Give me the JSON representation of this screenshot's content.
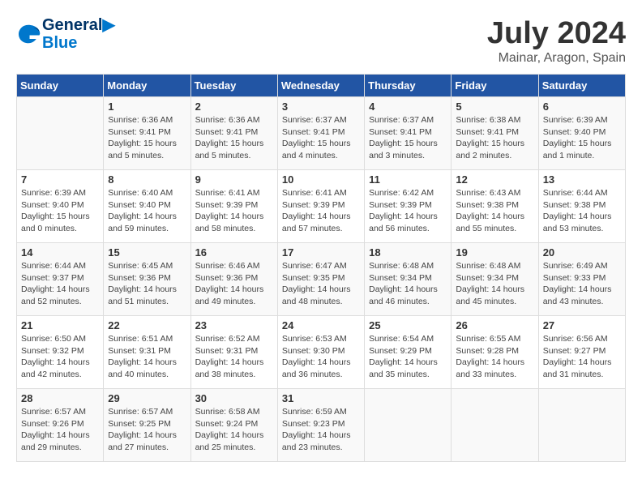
{
  "header": {
    "logo_line1": "General",
    "logo_line2": "Blue",
    "month": "July 2024",
    "location": "Mainar, Aragon, Spain"
  },
  "columns": [
    "Sunday",
    "Monday",
    "Tuesday",
    "Wednesday",
    "Thursday",
    "Friday",
    "Saturday"
  ],
  "weeks": [
    [
      {
        "date": "",
        "info": ""
      },
      {
        "date": "1",
        "info": "Sunrise: 6:36 AM\nSunset: 9:41 PM\nDaylight: 15 hours\nand 5 minutes."
      },
      {
        "date": "2",
        "info": "Sunrise: 6:36 AM\nSunset: 9:41 PM\nDaylight: 15 hours\nand 5 minutes."
      },
      {
        "date": "3",
        "info": "Sunrise: 6:37 AM\nSunset: 9:41 PM\nDaylight: 15 hours\nand 4 minutes."
      },
      {
        "date": "4",
        "info": "Sunrise: 6:37 AM\nSunset: 9:41 PM\nDaylight: 15 hours\nand 3 minutes."
      },
      {
        "date": "5",
        "info": "Sunrise: 6:38 AM\nSunset: 9:41 PM\nDaylight: 15 hours\nand 2 minutes."
      },
      {
        "date": "6",
        "info": "Sunrise: 6:39 AM\nSunset: 9:40 PM\nDaylight: 15 hours\nand 1 minute."
      }
    ],
    [
      {
        "date": "7",
        "info": "Sunrise: 6:39 AM\nSunset: 9:40 PM\nDaylight: 15 hours\nand 0 minutes."
      },
      {
        "date": "8",
        "info": "Sunrise: 6:40 AM\nSunset: 9:40 PM\nDaylight: 14 hours\nand 59 minutes."
      },
      {
        "date": "9",
        "info": "Sunrise: 6:41 AM\nSunset: 9:39 PM\nDaylight: 14 hours\nand 58 minutes."
      },
      {
        "date": "10",
        "info": "Sunrise: 6:41 AM\nSunset: 9:39 PM\nDaylight: 14 hours\nand 57 minutes."
      },
      {
        "date": "11",
        "info": "Sunrise: 6:42 AM\nSunset: 9:39 PM\nDaylight: 14 hours\nand 56 minutes."
      },
      {
        "date": "12",
        "info": "Sunrise: 6:43 AM\nSunset: 9:38 PM\nDaylight: 14 hours\nand 55 minutes."
      },
      {
        "date": "13",
        "info": "Sunrise: 6:44 AM\nSunset: 9:38 PM\nDaylight: 14 hours\nand 53 minutes."
      }
    ],
    [
      {
        "date": "14",
        "info": "Sunrise: 6:44 AM\nSunset: 9:37 PM\nDaylight: 14 hours\nand 52 minutes."
      },
      {
        "date": "15",
        "info": "Sunrise: 6:45 AM\nSunset: 9:36 PM\nDaylight: 14 hours\nand 51 minutes."
      },
      {
        "date": "16",
        "info": "Sunrise: 6:46 AM\nSunset: 9:36 PM\nDaylight: 14 hours\nand 49 minutes."
      },
      {
        "date": "17",
        "info": "Sunrise: 6:47 AM\nSunset: 9:35 PM\nDaylight: 14 hours\nand 48 minutes."
      },
      {
        "date": "18",
        "info": "Sunrise: 6:48 AM\nSunset: 9:34 PM\nDaylight: 14 hours\nand 46 minutes."
      },
      {
        "date": "19",
        "info": "Sunrise: 6:48 AM\nSunset: 9:34 PM\nDaylight: 14 hours\nand 45 minutes."
      },
      {
        "date": "20",
        "info": "Sunrise: 6:49 AM\nSunset: 9:33 PM\nDaylight: 14 hours\nand 43 minutes."
      }
    ],
    [
      {
        "date": "21",
        "info": "Sunrise: 6:50 AM\nSunset: 9:32 PM\nDaylight: 14 hours\nand 42 minutes."
      },
      {
        "date": "22",
        "info": "Sunrise: 6:51 AM\nSunset: 9:31 PM\nDaylight: 14 hours\nand 40 minutes."
      },
      {
        "date": "23",
        "info": "Sunrise: 6:52 AM\nSunset: 9:31 PM\nDaylight: 14 hours\nand 38 minutes."
      },
      {
        "date": "24",
        "info": "Sunrise: 6:53 AM\nSunset: 9:30 PM\nDaylight: 14 hours\nand 36 minutes."
      },
      {
        "date": "25",
        "info": "Sunrise: 6:54 AM\nSunset: 9:29 PM\nDaylight: 14 hours\nand 35 minutes."
      },
      {
        "date": "26",
        "info": "Sunrise: 6:55 AM\nSunset: 9:28 PM\nDaylight: 14 hours\nand 33 minutes."
      },
      {
        "date": "27",
        "info": "Sunrise: 6:56 AM\nSunset: 9:27 PM\nDaylight: 14 hours\nand 31 minutes."
      }
    ],
    [
      {
        "date": "28",
        "info": "Sunrise: 6:57 AM\nSunset: 9:26 PM\nDaylight: 14 hours\nand 29 minutes."
      },
      {
        "date": "29",
        "info": "Sunrise: 6:57 AM\nSunset: 9:25 PM\nDaylight: 14 hours\nand 27 minutes."
      },
      {
        "date": "30",
        "info": "Sunrise: 6:58 AM\nSunset: 9:24 PM\nDaylight: 14 hours\nand 25 minutes."
      },
      {
        "date": "31",
        "info": "Sunrise: 6:59 AM\nSunset: 9:23 PM\nDaylight: 14 hours\nand 23 minutes."
      },
      {
        "date": "",
        "info": ""
      },
      {
        "date": "",
        "info": ""
      },
      {
        "date": "",
        "info": ""
      }
    ]
  ]
}
